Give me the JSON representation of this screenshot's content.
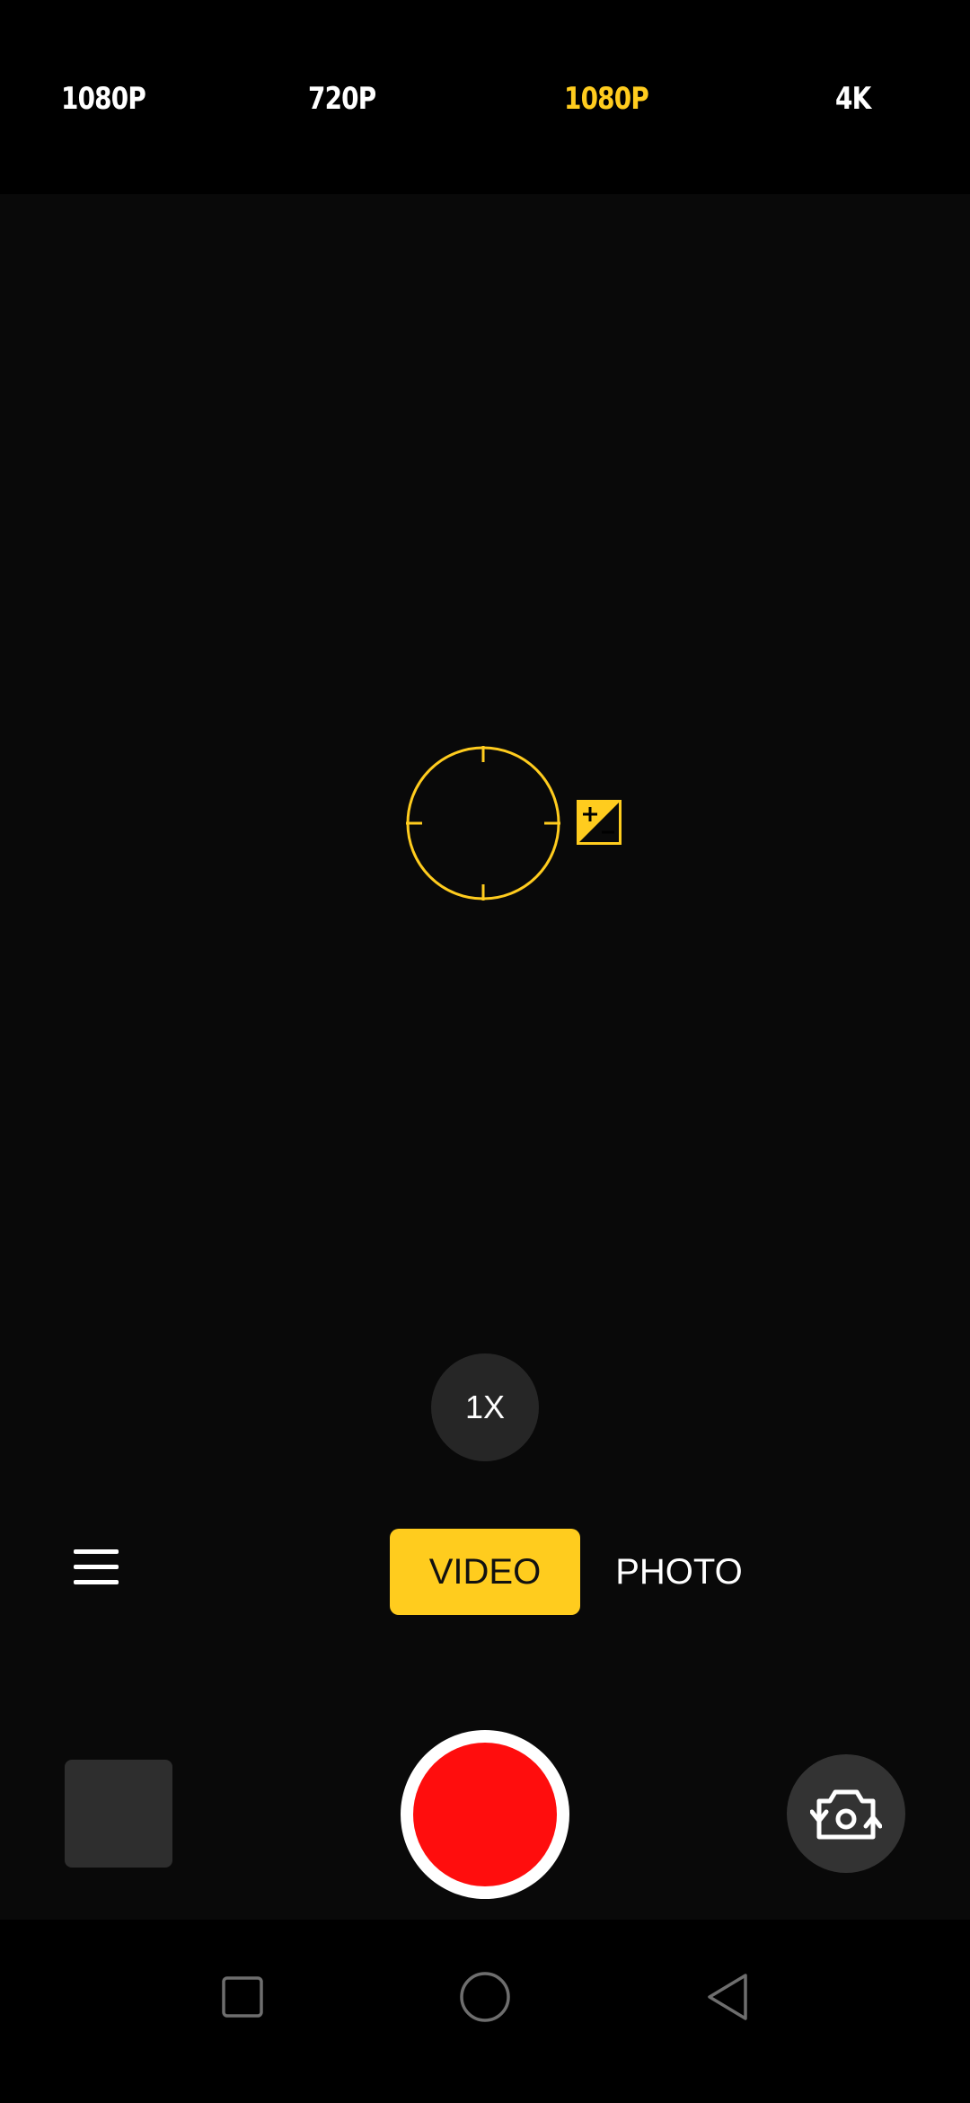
{
  "resolution_bar": {
    "items": [
      {
        "label": "1080P",
        "active": false
      },
      {
        "label": "720P",
        "active": false
      },
      {
        "label": "1080P",
        "active": true
      },
      {
        "label": "4K",
        "active": false
      }
    ]
  },
  "viewfinder": {
    "zoom_label": "1X",
    "focus_icon": "focus-ring-icon",
    "exposure_icon": "exposure-compensation-icon"
  },
  "modes": {
    "video_label": "VIDEO",
    "photo_label": "PHOTO",
    "selected": "VIDEO"
  },
  "controls": {
    "menu_icon": "hamburger-menu-icon",
    "gallery": "gallery-thumbnail",
    "record_icon": "record-button",
    "switch_icon": "switch-camera-icon"
  },
  "navigation": {
    "recents_icon": "square-icon",
    "home_icon": "circle-icon",
    "back_icon": "triangle-back-icon"
  },
  "colors": {
    "accent": "#ffcc1e",
    "record": "#ff0d0d",
    "background": "#000000",
    "viewfinder": "#090909"
  }
}
